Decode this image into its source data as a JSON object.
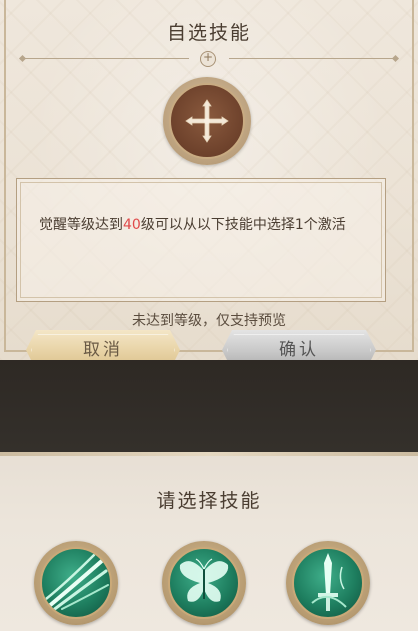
{
  "dialog": {
    "title": "自选技能",
    "description_prefix": "觉醒等级达到",
    "level": "40",
    "description_suffix": "级可以从以下技能中选择1个激活",
    "notice": "未达到等级，仅支持预览",
    "cancel_label": "取消",
    "confirm_label": "确认"
  },
  "selection": {
    "title": "请选择技能",
    "options": [
      {
        "icon": "claw-slash-icon"
      },
      {
        "icon": "butterfly-icon"
      },
      {
        "icon": "sword-icon"
      }
    ]
  },
  "colors": {
    "highlight": "#e04a4a",
    "skill_green": "#1e7e5f",
    "slot_brown": "#6d412b"
  }
}
